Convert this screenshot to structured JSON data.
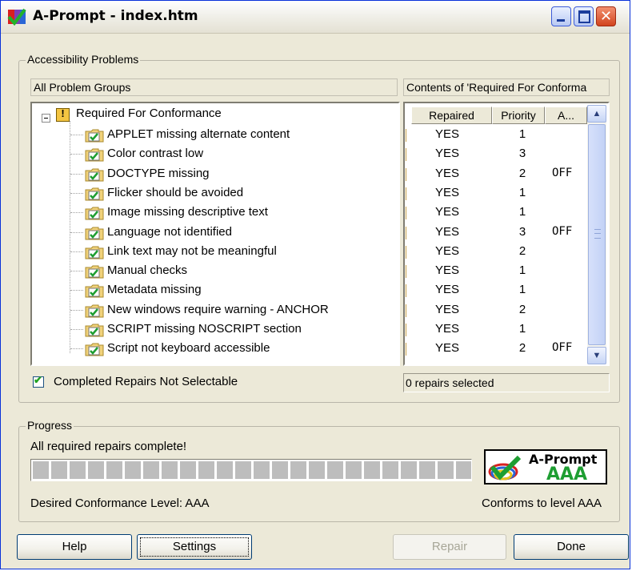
{
  "window": {
    "title": "A-Prompt - index.htm",
    "close_glyph": "✕"
  },
  "problems": {
    "group_label": "Accessibility Problems",
    "left_header": "All Problem Groups",
    "right_header": "Contents of 'Required For Conforma",
    "root": "Required For Conformance",
    "items": [
      "APPLET missing alternate content",
      "Color contrast low",
      "DOCTYPE missing",
      "Flicker should be avoided",
      "Image missing descriptive text",
      "Language not identified",
      "Link text may not be meaningful",
      "Manual checks",
      "Metadata missing",
      "New windows require warning - ANCHOR",
      "SCRIPT missing NOSCRIPT section",
      "Script not keyboard accessible"
    ],
    "columns": [
      "Repaired",
      "Priority",
      "A..."
    ],
    "rows": [
      {
        "repaired": "YES",
        "priority": "1",
        "a": ""
      },
      {
        "repaired": "YES",
        "priority": "3",
        "a": ""
      },
      {
        "repaired": "YES",
        "priority": "2",
        "a": "OFF"
      },
      {
        "repaired": "YES",
        "priority": "1",
        "a": ""
      },
      {
        "repaired": "YES",
        "priority": "1",
        "a": ""
      },
      {
        "repaired": "YES",
        "priority": "3",
        "a": "OFF"
      },
      {
        "repaired": "YES",
        "priority": "2",
        "a": ""
      },
      {
        "repaired": "YES",
        "priority": "1",
        "a": ""
      },
      {
        "repaired": "YES",
        "priority": "1",
        "a": ""
      },
      {
        "repaired": "YES",
        "priority": "2",
        "a": ""
      },
      {
        "repaired": "YES",
        "priority": "1",
        "a": ""
      },
      {
        "repaired": "YES",
        "priority": "2",
        "a": "OFF"
      }
    ],
    "checkbox_label": "Completed Repairs Not Selectable",
    "checkbox_checked": true,
    "check_glyph": "✔",
    "status": "0 repairs selected",
    "scroll_up": "▲",
    "scroll_down": "▼"
  },
  "progress": {
    "group_label": "Progress",
    "message": "All required repairs complete!",
    "value": 1.0,
    "segments": 24,
    "desired_level": "Desired Conformance Level: AAA",
    "conforms": "Conforms to level AAA",
    "logo_line1": "A-Prompt",
    "logo_line2": "AAA"
  },
  "buttons": {
    "help": "Help",
    "settings": "Settings",
    "repair": "Repair",
    "done": "Done"
  },
  "colors": {
    "title_bar_border": "#0831d9",
    "logo_green": "#1e9e32",
    "check_green": "#21a121",
    "dialog_bg": "#ece9d8"
  }
}
